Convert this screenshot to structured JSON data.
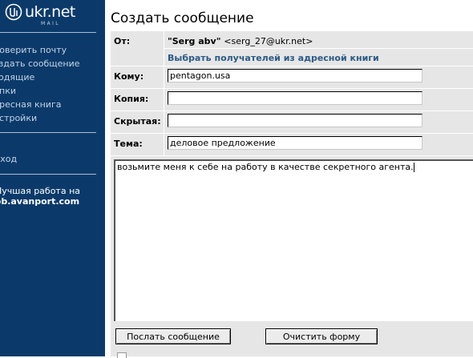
{
  "app": {
    "logo_text": "ukr.net",
    "logo_sub": "MAIL"
  },
  "sidebar": {
    "nav_items": [
      {
        "label": "Проверить почту"
      },
      {
        "label": "Создать сообщение"
      },
      {
        "label": "Входящие"
      },
      {
        "label": "Папки"
      },
      {
        "label": "Адресная книга"
      },
      {
        "label": "Настройки"
      }
    ],
    "logout_label": "Выход",
    "promo_line1": "Лучшая работа на",
    "promo_line2": "job.avanport.com"
  },
  "page": {
    "title": "Создать сообщение"
  },
  "form": {
    "from_label": "От:",
    "from_name": "\"Serg abv\"",
    "from_address": "<serg_27@ukr.net>",
    "address_book_link": "Выбрать получателей из адресной книги",
    "to_label": "Кому:",
    "to_value": "pentagon.usa",
    "cc_label": "Копия:",
    "cc_value": "",
    "bcc_label": "Скрытая:",
    "bcc_value": "",
    "subject_label": "Тема:",
    "subject_value": "деловое предложение",
    "body_text": "возьмите меня к себе на работу в качестве секретного агента.",
    "send_label": "Послать сообщение",
    "clear_label": "Очистить форму"
  },
  "colors": {
    "sidebar_bg": "#0b3a6a",
    "form_bg": "#e6e6e6",
    "link": "#2b5a86"
  }
}
